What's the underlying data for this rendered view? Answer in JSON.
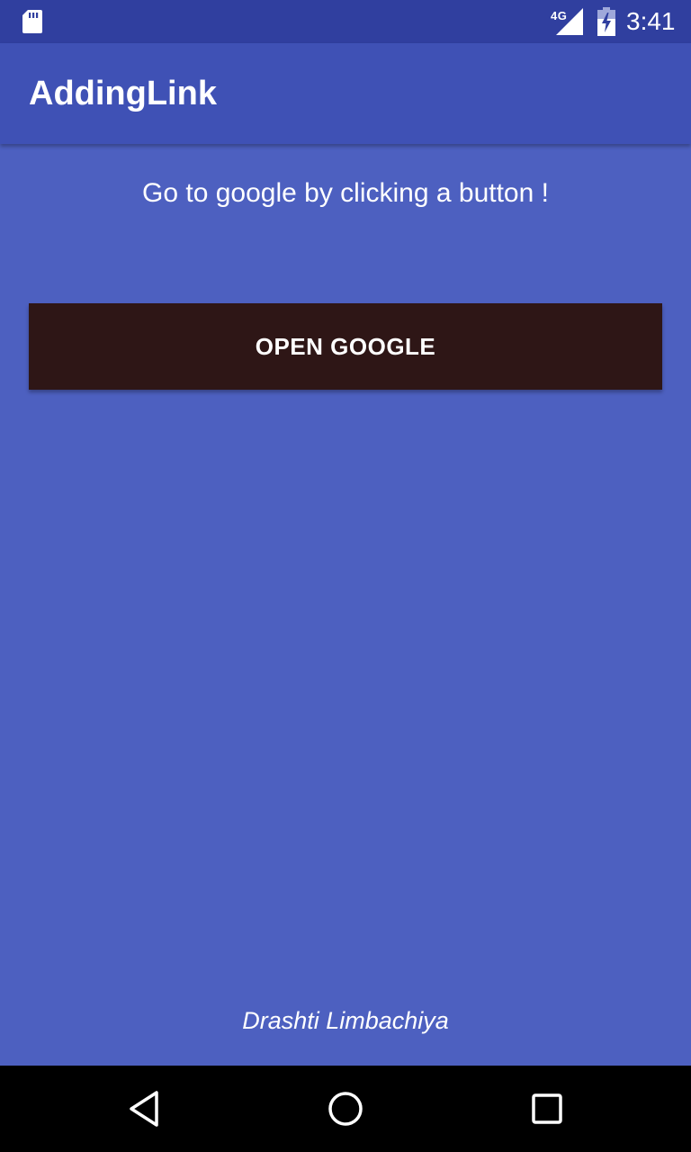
{
  "status_bar": {
    "network_type": "4G",
    "time": "3:41",
    "icons": [
      "sd-card-icon",
      "signal-icon",
      "battery-charging-icon"
    ]
  },
  "app_bar": {
    "title": "AddingLink"
  },
  "main": {
    "prompt": "Go to google by clicking a button !",
    "button_label": "OPEN GOOGLE",
    "author": "Drashti Limbachiya"
  },
  "nav_bar": {
    "icons": [
      "back-icon",
      "home-icon",
      "recents-icon"
    ]
  },
  "colors": {
    "status_bar": "#303F9F",
    "app_bar": "#3F51B5",
    "background": "#4D60C0",
    "button": "#2E1616",
    "nav_bar": "#000000"
  }
}
